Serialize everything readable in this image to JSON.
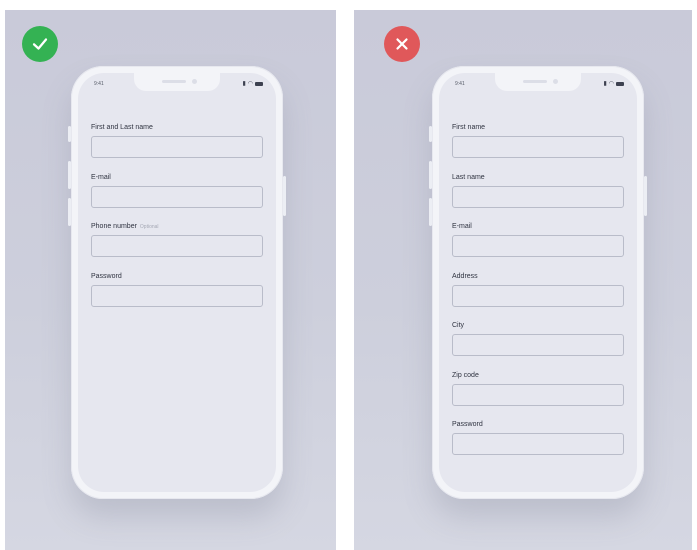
{
  "colors": {
    "good_badge": "#34b253",
    "bad_badge": "#e0585a",
    "panel_bg": "#cbcddb",
    "screen_bg": "#e6e7ef"
  },
  "left": {
    "badge_icon": "check-icon",
    "status_time": "9:41",
    "fields": [
      {
        "label": "First and Last name"
      },
      {
        "label": "E-mail"
      },
      {
        "label": "Phone number",
        "optional": "Optional"
      },
      {
        "label": "Password"
      }
    ]
  },
  "right": {
    "badge_icon": "close-icon",
    "status_time": "9:41",
    "fields": [
      {
        "label": "First name"
      },
      {
        "label": "Last name"
      },
      {
        "label": "E-mail"
      },
      {
        "label": "Address"
      },
      {
        "label": "City"
      },
      {
        "label": "Zip code"
      },
      {
        "label": "Password"
      }
    ]
  }
}
